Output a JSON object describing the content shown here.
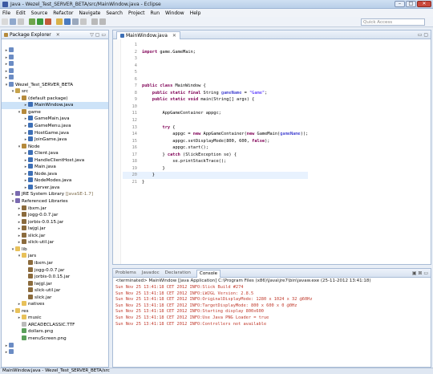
{
  "window": {
    "title": "Java - Wezel_Test_SERVER_BETA/src/MainWindow.java - Eclipse",
    "controls": [
      "–",
      "□",
      "✕"
    ]
  },
  "menu": [
    "File",
    "Edit",
    "Source",
    "Refactor",
    "Navigate",
    "Search",
    "Project",
    "Run",
    "Window",
    "Help"
  ],
  "quick_access": {
    "placeholder": "Quick Access"
  },
  "package_explorer": {
    "title": "Package Explorer",
    "close": "✕",
    "controls": "▽ ▢ ▭",
    "tree": [
      {
        "level": 0,
        "twisty": "▸",
        "icon": "proj",
        "label": ""
      },
      {
        "level": 0,
        "twisty": "▸",
        "icon": "proj",
        "label": ""
      },
      {
        "level": 0,
        "twisty": "▸",
        "icon": "proj",
        "label": ""
      },
      {
        "level": 0,
        "twisty": "▸",
        "icon": "proj",
        "label": ""
      },
      {
        "level": 0,
        "twisty": "▸",
        "icon": "proj",
        "label": ""
      },
      {
        "level": 0,
        "twisty": "▾",
        "icon": "proj",
        "label": "Wezel_Test_SERVER_BETA"
      },
      {
        "level": 1,
        "twisty": "▾",
        "icon": "src",
        "label": "src"
      },
      {
        "level": 2,
        "twisty": "▾",
        "icon": "pkg",
        "label": "(default package)"
      },
      {
        "level": 3,
        "twisty": "▸",
        "icon": "java",
        "label": "MainWindow.java",
        "selected": true
      },
      {
        "level": 2,
        "twisty": "▾",
        "icon": "pkg",
        "label": "game"
      },
      {
        "level": 3,
        "twisty": "▸",
        "icon": "java",
        "label": "GameMain.java"
      },
      {
        "level": 3,
        "twisty": "▸",
        "icon": "java",
        "label": "GameMenu.java"
      },
      {
        "level": 3,
        "twisty": "▸",
        "icon": "java",
        "label": "HostGame.java"
      },
      {
        "level": 3,
        "twisty": "▸",
        "icon": "java",
        "label": "JoinGame.java"
      },
      {
        "level": 2,
        "twisty": "▾",
        "icon": "pkg",
        "label": "Node"
      },
      {
        "level": 3,
        "twisty": "▸",
        "icon": "java",
        "label": "Client.java"
      },
      {
        "level": 3,
        "twisty": "▸",
        "icon": "java",
        "label": "HandleClientHost.java"
      },
      {
        "level": 3,
        "twisty": "▸",
        "icon": "java",
        "label": "Main.java"
      },
      {
        "level": 3,
        "twisty": "▸",
        "icon": "java",
        "label": "Node.java"
      },
      {
        "level": 3,
        "twisty": "▸",
        "icon": "java",
        "label": "NodeModes.java"
      },
      {
        "level": 3,
        "twisty": "▸",
        "icon": "java",
        "label": "Server.java"
      },
      {
        "level": 1,
        "twisty": "▸",
        "icon": "lib",
        "label": "JRE System Library",
        "decoration": "[JavaSE-1.7]"
      },
      {
        "level": 1,
        "twisty": "▾",
        "icon": "lib",
        "label": "Referenced Libraries"
      },
      {
        "level": 2,
        "twisty": "▸",
        "icon": "jar",
        "label": "ibxm.jar"
      },
      {
        "level": 2,
        "twisty": "▸",
        "icon": "jar",
        "label": "jogg-0.0.7.jar"
      },
      {
        "level": 2,
        "twisty": "▸",
        "icon": "jar",
        "label": "jorbis-0.0.15.jar"
      },
      {
        "level": 2,
        "twisty": "▸",
        "icon": "jar",
        "label": "lwjgl.jar"
      },
      {
        "level": 2,
        "twisty": "▸",
        "icon": "jar",
        "label": "slick.jar"
      },
      {
        "level": 2,
        "twisty": "▸",
        "icon": "jar",
        "label": "slick-util.jar"
      },
      {
        "level": 1,
        "twisty": "▾",
        "icon": "folder",
        "label": "lib"
      },
      {
        "level": 2,
        "twisty": "▾",
        "icon": "folder",
        "label": "jars"
      },
      {
        "level": 3,
        "twisty": "",
        "icon": "jar",
        "label": "ibxm.jar"
      },
      {
        "level": 3,
        "twisty": "",
        "icon": "jar",
        "label": "jogg-0.0.7.jar"
      },
      {
        "level": 3,
        "twisty": "",
        "icon": "jar",
        "label": "jorbis-0.0.15.jar"
      },
      {
        "level": 3,
        "twisty": "",
        "icon": "jar",
        "label": "lwjgl.jar"
      },
      {
        "level": 3,
        "twisty": "",
        "icon": "jar",
        "label": "slick-util.jar"
      },
      {
        "level": 3,
        "twisty": "",
        "icon": "jar",
        "label": "slick.jar"
      },
      {
        "level": 2,
        "twisty": "▸",
        "icon": "folder",
        "label": "natives"
      },
      {
        "level": 1,
        "twisty": "▾",
        "icon": "folder",
        "label": "res"
      },
      {
        "level": 2,
        "twisty": "▸",
        "icon": "folder",
        "label": "music"
      },
      {
        "level": 2,
        "twisty": "",
        "icon": "file",
        "label": "ARCADECLASSIC.TTF"
      },
      {
        "level": 2,
        "twisty": "",
        "icon": "img",
        "label": "dollars.png"
      },
      {
        "level": 2,
        "twisty": "",
        "icon": "img",
        "label": "menuScreen.png"
      },
      {
        "level": 0,
        "twisty": "▸",
        "icon": "proj",
        "label": ""
      },
      {
        "level": 0,
        "twisty": "▸",
        "icon": "proj",
        "label": ""
      }
    ]
  },
  "editor": {
    "tab": "MainWindow.java",
    "close": "✕",
    "controls": "▭ ▢",
    "lines": [
      {
        "n": "1",
        "html": ""
      },
      {
        "n": "2",
        "html": "<span class=\"kw\">import</span> game.GameMain;"
      },
      {
        "n": "3",
        "html": ""
      },
      {
        "n": "4",
        "html": ""
      },
      {
        "n": "5",
        "html": ""
      },
      {
        "n": "6",
        "html": ""
      },
      {
        "n": "7",
        "html": "<span class=\"kw\">public class</span> MainWindow {"
      },
      {
        "n": "8",
        "html": "    <span class=\"kw\">public static final</span> String <span class=\"fld\">gameName</span> = <span class=\"str\">\"Game\"</span>;"
      },
      {
        "n": "9",
        "html": "    <span class=\"kw\">public static void</span> main(String[] args) {"
      },
      {
        "n": "10",
        "html": ""
      },
      {
        "n": "11",
        "html": "        AppGameContainer appgc;"
      },
      {
        "n": "12",
        "html": ""
      },
      {
        "n": "13",
        "html": "        <span class=\"kw\">try</span> {"
      },
      {
        "n": "14",
        "html": "            appgc = <span class=\"kw\">new</span> AppGameContainer(<span class=\"kw\">new</span> GameMain(<span class=\"fld\">gameName</span>));"
      },
      {
        "n": "15",
        "html": "            appgc.setDisplayMode(800, 600, <span class=\"kw\">false</span>);"
      },
      {
        "n": "16",
        "html": "            appgc.start();"
      },
      {
        "n": "17",
        "html": "        } <span class=\"kw\">catch</span> (SlickException se) {"
      },
      {
        "n": "18",
        "html": "            se.printStackTrace();"
      },
      {
        "n": "19",
        "html": "        }"
      },
      {
        "n": "20",
        "html": "    }",
        "highlight": true
      },
      {
        "n": "21",
        "html": "}"
      }
    ]
  },
  "console": {
    "tabs": [
      "Problems",
      "Javadoc",
      "Declaration",
      "Console"
    ],
    "active_tab": "Console",
    "controls": "▣ ⊠ ▭",
    "terminated": "<terminated> MainWindow [Java Application] C:\\Program Files (x86)\\Java\\jre7\\bin\\javaw.exe (25-11-2012 13:41:18)",
    "lines": [
      "Sun Nov 25 13:41:18 CET 2012 INFO:Slick Build #274",
      "Sun Nov 25 13:41:18 CET 2012 INFO:LWJGL Version: 2.8.5",
      "Sun Nov 25 13:41:18 CET 2012 INFO:OriginalDisplayMode: 1280 x 1024 x 32 @60Hz",
      "Sun Nov 25 13:41:18 CET 2012 INFO:TargetDisplayMode: 800 x 600 x 0 @0Hz",
      "Sun Nov 25 13:41:18 CET 2012 INFO:Starting display 800x600",
      "Sun Nov 25 13:41:18 CET 2012 INFO:Use Java PNG Loader = true",
      "Sun Nov 25 13:41:18 CET 2012 INFO:Controllers not available"
    ]
  },
  "status": "MainWindow.java - Wezel_Test_SERVER_BETA/src"
}
